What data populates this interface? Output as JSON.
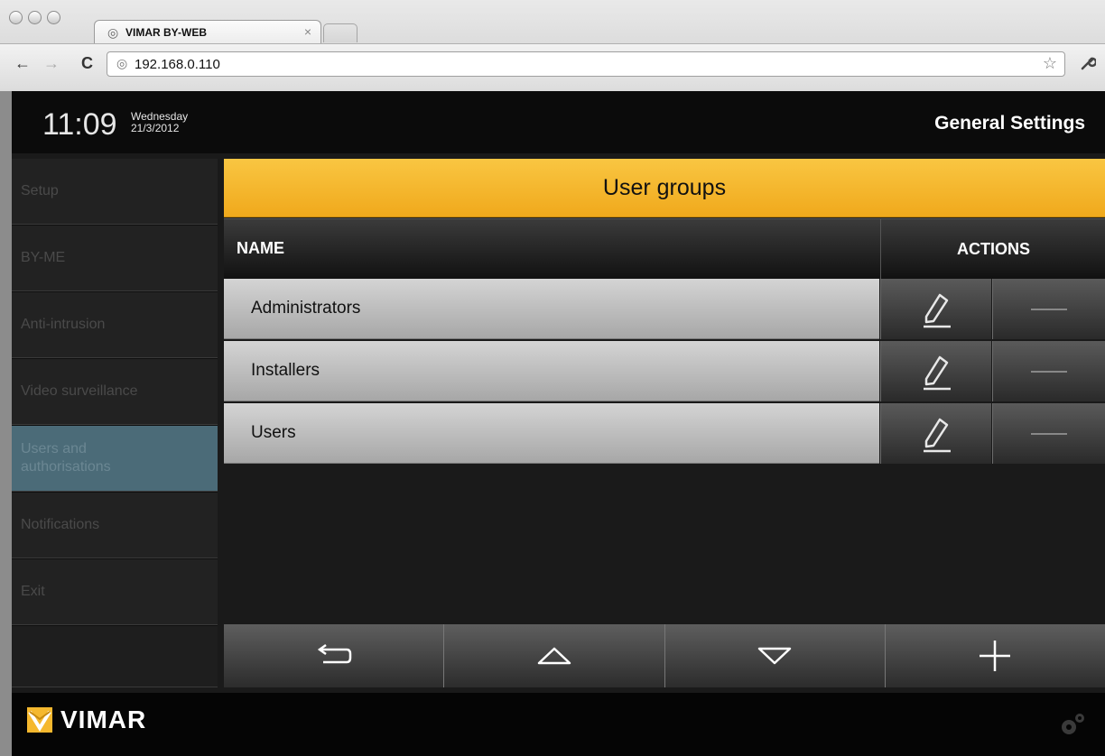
{
  "browser": {
    "tab_title": "VIMAR BY-WEB",
    "tab_close": "×",
    "url": "192.168.0.110",
    "back": "←",
    "forward": "→",
    "reload": "C",
    "star": "☆",
    "wrench": "🔧",
    "globe": "◎"
  },
  "header": {
    "time": "11:09",
    "day": "Wednesday",
    "date": "21/3/2012",
    "title": "General Settings"
  },
  "sidebar": {
    "items": [
      {
        "label": "Setup"
      },
      {
        "label": "BY-ME"
      },
      {
        "label": "Anti-intrusion"
      },
      {
        "label": "Video surveillance"
      },
      {
        "label": "Users and authorisations",
        "active": true
      },
      {
        "label": "Notifications"
      },
      {
        "label": "Exit"
      }
    ]
  },
  "main": {
    "section_title": "User groups",
    "columns": {
      "name": "NAME",
      "actions": "ACTIONS"
    },
    "rows": [
      {
        "name": "Administrators"
      },
      {
        "name": "Installers"
      },
      {
        "name": "Users"
      }
    ]
  },
  "footer": {
    "brand": "VIMAR"
  },
  "colors": {
    "accent": "#f5b82e",
    "active_item": "#4b6b78"
  },
  "icons": {
    "back": "back-arrow-icon",
    "up": "triangle-up-icon",
    "down": "triangle-down-icon",
    "add": "plus-icon",
    "edit": "pencil-icon",
    "delete": "minus-icon",
    "settings": "gear-icon"
  }
}
